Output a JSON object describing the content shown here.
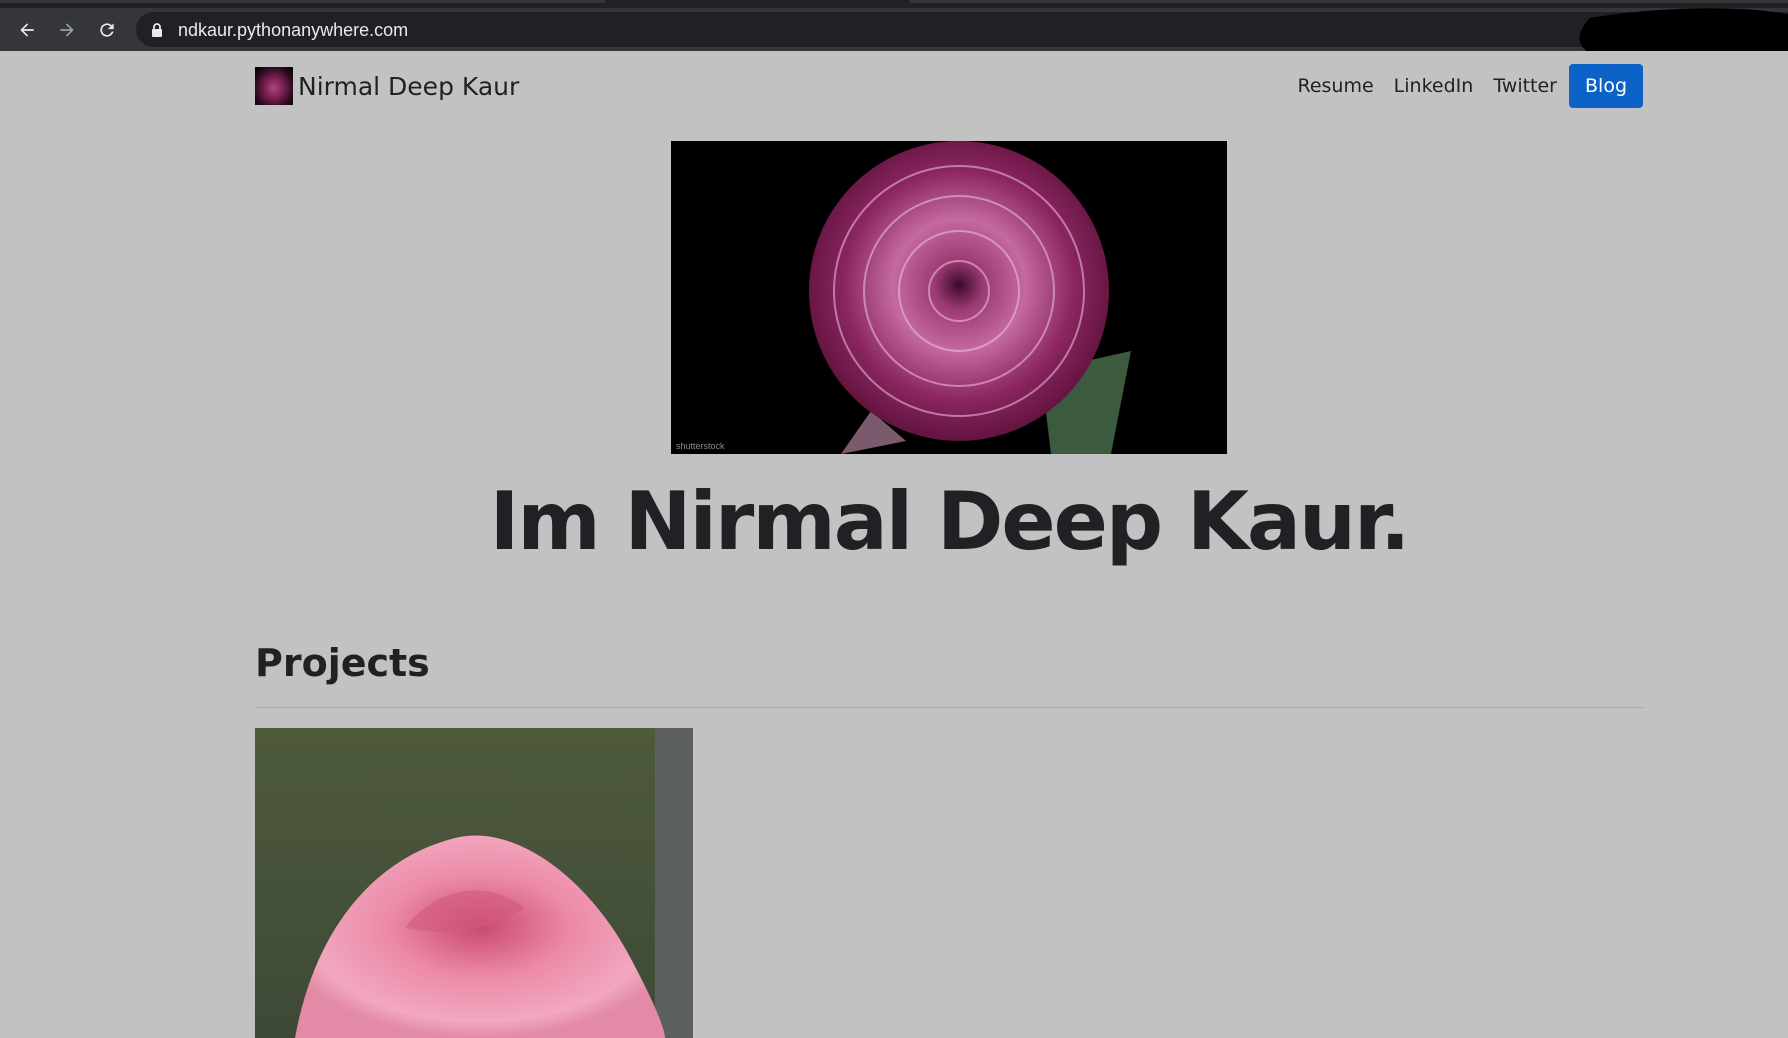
{
  "browser": {
    "url": "ndkaur.pythonanywhere.com",
    "icons": [
      "back-arrow-icon",
      "forward-arrow-icon",
      "reload-icon",
      "lock-icon"
    ]
  },
  "navbar": {
    "brand_name": "Nirmal Deep Kaur",
    "links": [
      "Resume",
      "LinkedIn",
      "Twitter"
    ],
    "active_link": "Blog",
    "active_color": "#0d62c8"
  },
  "hero": {
    "image_watermark": "shutterstock",
    "title": "Im Nirmal Deep Kaur."
  },
  "projects": {
    "heading": "Projects"
  }
}
